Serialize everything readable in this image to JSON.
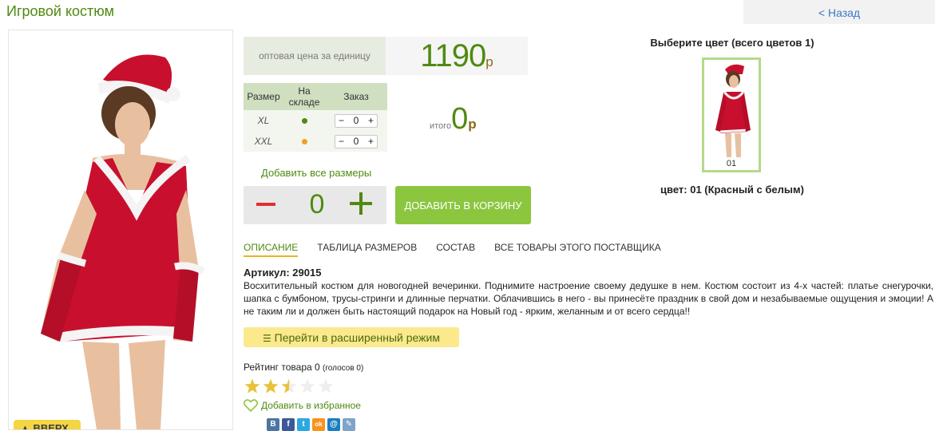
{
  "product": {
    "title": "Игровой костюм",
    "back_label": "< Назад",
    "up_label": "▲ ВВЕРХ"
  },
  "price": {
    "label": "оптовая цена за единицу",
    "value": "1190",
    "currency": "р"
  },
  "sizes_table": {
    "headers": [
      "Размер",
      "На складе",
      "Заказ"
    ],
    "rows": [
      {
        "size": "XL",
        "stock_color": "#4f8a10",
        "qty": "0",
        "minus": "−",
        "plus": "+"
      },
      {
        "size": "XXL",
        "stock_color": "#f0a020",
        "qty": "0",
        "minus": "−",
        "plus": "+"
      }
    ]
  },
  "total": {
    "label": "итого",
    "value": "0",
    "currency": "р"
  },
  "order": {
    "add_all_label": "Добавить все размеры",
    "quantity": "0",
    "cart_label": "ДОБАВИТЬ В КОРЗИНУ"
  },
  "tabs": [
    {
      "label": "ОПИСАНИЕ",
      "active": true
    },
    {
      "label": "ТАБЛИЦА РАЗМЕРОВ",
      "active": false
    },
    {
      "label": "СОСТАВ",
      "active": false
    },
    {
      "label": "ВСЕ ТОВАРЫ ЭТОГО ПОСТАВЩИКА",
      "active": false
    }
  ],
  "description": {
    "article": "Артикул: 29015",
    "text": "Восхитительный костюм для новогодней вечеринки. Поднимите настроение своему дедушке в нем. Костюм состоит из 4-х частей: платье снегурочки, шапка с бумбоном, трусы-стринги и длинные перчатки. Облачившись в него - вы принесёте праздник в свой дом и незабываемые ощущения и эмоции! А не таким ли и должен быть настоящий подарок на Новый год - ярким, желанным и от всего сердца!!"
  },
  "extended_mode_label": "Перейти в расширенный режим",
  "rating": {
    "label": "Рейтинг товара 0",
    "votes": "(голосов 0)",
    "stars_filled": 2.5,
    "stars_total": 5,
    "star_color": "#e8c23a",
    "star_empty_color": "#eeeeee"
  },
  "favorite_label": "Добавить в избранное",
  "social_icons": [
    {
      "icon": "vk-icon",
      "glyph": "B",
      "color": "#4c75a3"
    },
    {
      "icon": "facebook-icon",
      "glyph": "f",
      "color": "#3b5998"
    },
    {
      "icon": "twitter-icon",
      "glyph": "t",
      "color": "#2ca8e0"
    },
    {
      "icon": "odnoklassniki-icon",
      "glyph": "ok",
      "color": "#f7931e"
    },
    {
      "icon": "mailru-icon",
      "glyph": "@",
      "color": "#1a7fbf"
    },
    {
      "icon": "livejournal-icon",
      "glyph": "✎",
      "color": "#7fa4c8"
    }
  ],
  "colors": {
    "choose_label": "Выберите цвет (всего цветов 1)",
    "thumb_label": "01",
    "selected_label": "цвет: 01 (Красный с белым)"
  },
  "theme": {
    "accent_green": "#4f8a10",
    "cart_green": "#8cc63f",
    "dress_red": "#c8102e"
  }
}
